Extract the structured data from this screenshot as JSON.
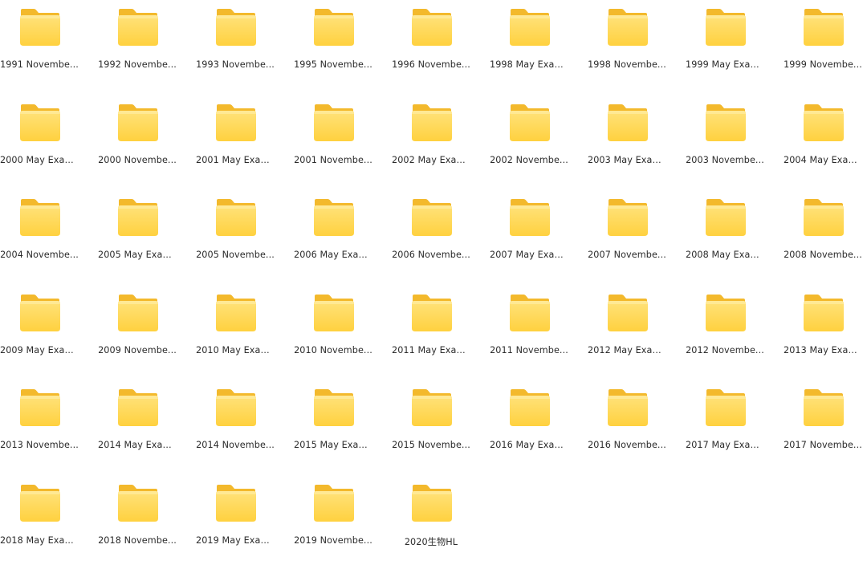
{
  "folders": [
    {
      "label": "1991 Novembe..."
    },
    {
      "label": "1992 Novembe..."
    },
    {
      "label": "1993 Novembe..."
    },
    {
      "label": "1995 Novembe..."
    },
    {
      "label": "1996 Novembe..."
    },
    {
      "label": "1998 May Exam..."
    },
    {
      "label": "1998 Novembe..."
    },
    {
      "label": "1999 May Exam..."
    },
    {
      "label": "1999 Novembe..."
    },
    {
      "label": "2000 May Exam..."
    },
    {
      "label": "2000 Novembe..."
    },
    {
      "label": "2001 May Exam..."
    },
    {
      "label": "2001 Novembe..."
    },
    {
      "label": "2002 May Exam..."
    },
    {
      "label": "2002 Novembe..."
    },
    {
      "label": "2003 May Exam..."
    },
    {
      "label": "2003 Novembe..."
    },
    {
      "label": "2004 May Exam..."
    },
    {
      "label": "2004 Novembe..."
    },
    {
      "label": "2005 May Exam..."
    },
    {
      "label": "2005 Novembe..."
    },
    {
      "label": "2006 May Exam..."
    },
    {
      "label": "2006 Novembe..."
    },
    {
      "label": "2007 May Exam..."
    },
    {
      "label": "2007 Novembe..."
    },
    {
      "label": "2008 May Exam..."
    },
    {
      "label": "2008 Novembe..."
    },
    {
      "label": "2009 May Exam..."
    },
    {
      "label": "2009 Novembe..."
    },
    {
      "label": "2010 May Exam..."
    },
    {
      "label": "2010 Novembe..."
    },
    {
      "label": "2011 May Exam..."
    },
    {
      "label": "2011 Novembe..."
    },
    {
      "label": "2012 May Exam..."
    },
    {
      "label": "2012 Novembe..."
    },
    {
      "label": "2013 May Exam..."
    },
    {
      "label": "2013 Novembe..."
    },
    {
      "label": "2014 May Exam..."
    },
    {
      "label": "2014 Novembe..."
    },
    {
      "label": "2015 May Exam..."
    },
    {
      "label": "2015 Novembe..."
    },
    {
      "label": "2016 May Exam..."
    },
    {
      "label": "2016 Novembe..."
    },
    {
      "label": "2017 May Exam..."
    },
    {
      "label": "2017 Novembe..."
    },
    {
      "label": "2018 May Exam..."
    },
    {
      "label": "2018 Novembe..."
    },
    {
      "label": "2019 May Exam..."
    },
    {
      "label": "2019 Novembe..."
    },
    {
      "label": "2020生物HL"
    }
  ],
  "icon": "folder-icon",
  "colors": {
    "folder_back": "#F3B92C",
    "folder_front_top": "#FFE27A",
    "folder_front_bottom": "#FFD13F",
    "text": "#2b2b2b"
  }
}
